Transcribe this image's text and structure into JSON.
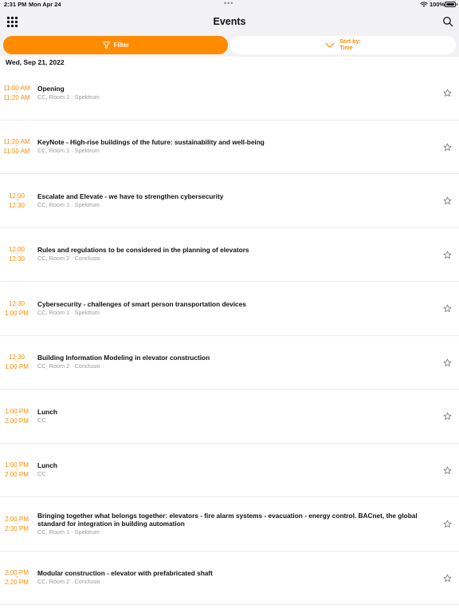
{
  "status_bar": {
    "time": "2:31 PM",
    "date": "Mon Apr 24",
    "dots": "•••",
    "battery": "100%",
    "battery_level": 1.0
  },
  "nav": {
    "title": "Events"
  },
  "toolbar": {
    "filter_label": "Filter",
    "sort_label": "Sort by:",
    "sort_value": "Time"
  },
  "date_header": "Wed, Sep 21, 2022",
  "colors": {
    "accent": "#ff8c00",
    "chrome_background": "#f2f2f4",
    "secondary_text": "#999999"
  },
  "icons": [
    "apps-grid-icon",
    "search-icon",
    "filter-icon",
    "chevron-down-icon",
    "star-icon",
    "wifi-icon",
    "battery-icon"
  ],
  "events": [
    {
      "start": "11:00 AM",
      "sep": "–",
      "end": "11:20 AM",
      "title": "Opening",
      "location": "CC, Room 1 · Spektrum"
    },
    {
      "start": "11:20 AM",
      "sep": "–",
      "end": "11:50 AM",
      "title": "KeyNote - High-rise buildings of the future: sustainability and well-being",
      "location": "CC, Room 1 · Spektrum"
    },
    {
      "start": "12:00",
      "sep": "–",
      "end": "12:30",
      "title": "Escalate and Elevate - we have to strengthen cybersecurity",
      "location": "CC, Room 1 · Spektrum"
    },
    {
      "start": "12:00",
      "sep": "–",
      "end": "12:30",
      "title": "Rules and regulations to be considered in the planning of elevators",
      "location": "CC, Room 2 · Conclusio"
    },
    {
      "start": "12:30",
      "sep": "–",
      "end": "1:00 PM",
      "title": "Cybersecurity - challenges of smart person transportation devices",
      "location": "CC, Room 1 · Spektrum"
    },
    {
      "start": "12:30",
      "sep": "–",
      "end": "1:00 PM",
      "title": "Building Information Modeling in elevator construction",
      "location": "CC, Room 2 · Conclusio"
    },
    {
      "start": "1:00 PM",
      "sep": "–",
      "end": "2:00 PM",
      "title": "Lunch",
      "location": "CC"
    },
    {
      "start": "1:00 PM",
      "sep": "–",
      "end": "2:00 PM",
      "title": "Lunch",
      "location": "CC"
    },
    {
      "start": "2:00 PM",
      "sep": "–",
      "end": "2:30 PM",
      "title": "Bringing together what belongs together: elevators - fire alarm systems - evacuation - energy control. BACnet, the global standard for integration in building automation",
      "location": "CC, Room 1 · Spektrum"
    },
    {
      "start": "2:00 PM",
      "sep": "–",
      "end": "2:20 PM",
      "title": "Modular construction - elevator with prefabricated shaft",
      "location": "CC, Room 2 · Conclusio"
    }
  ]
}
